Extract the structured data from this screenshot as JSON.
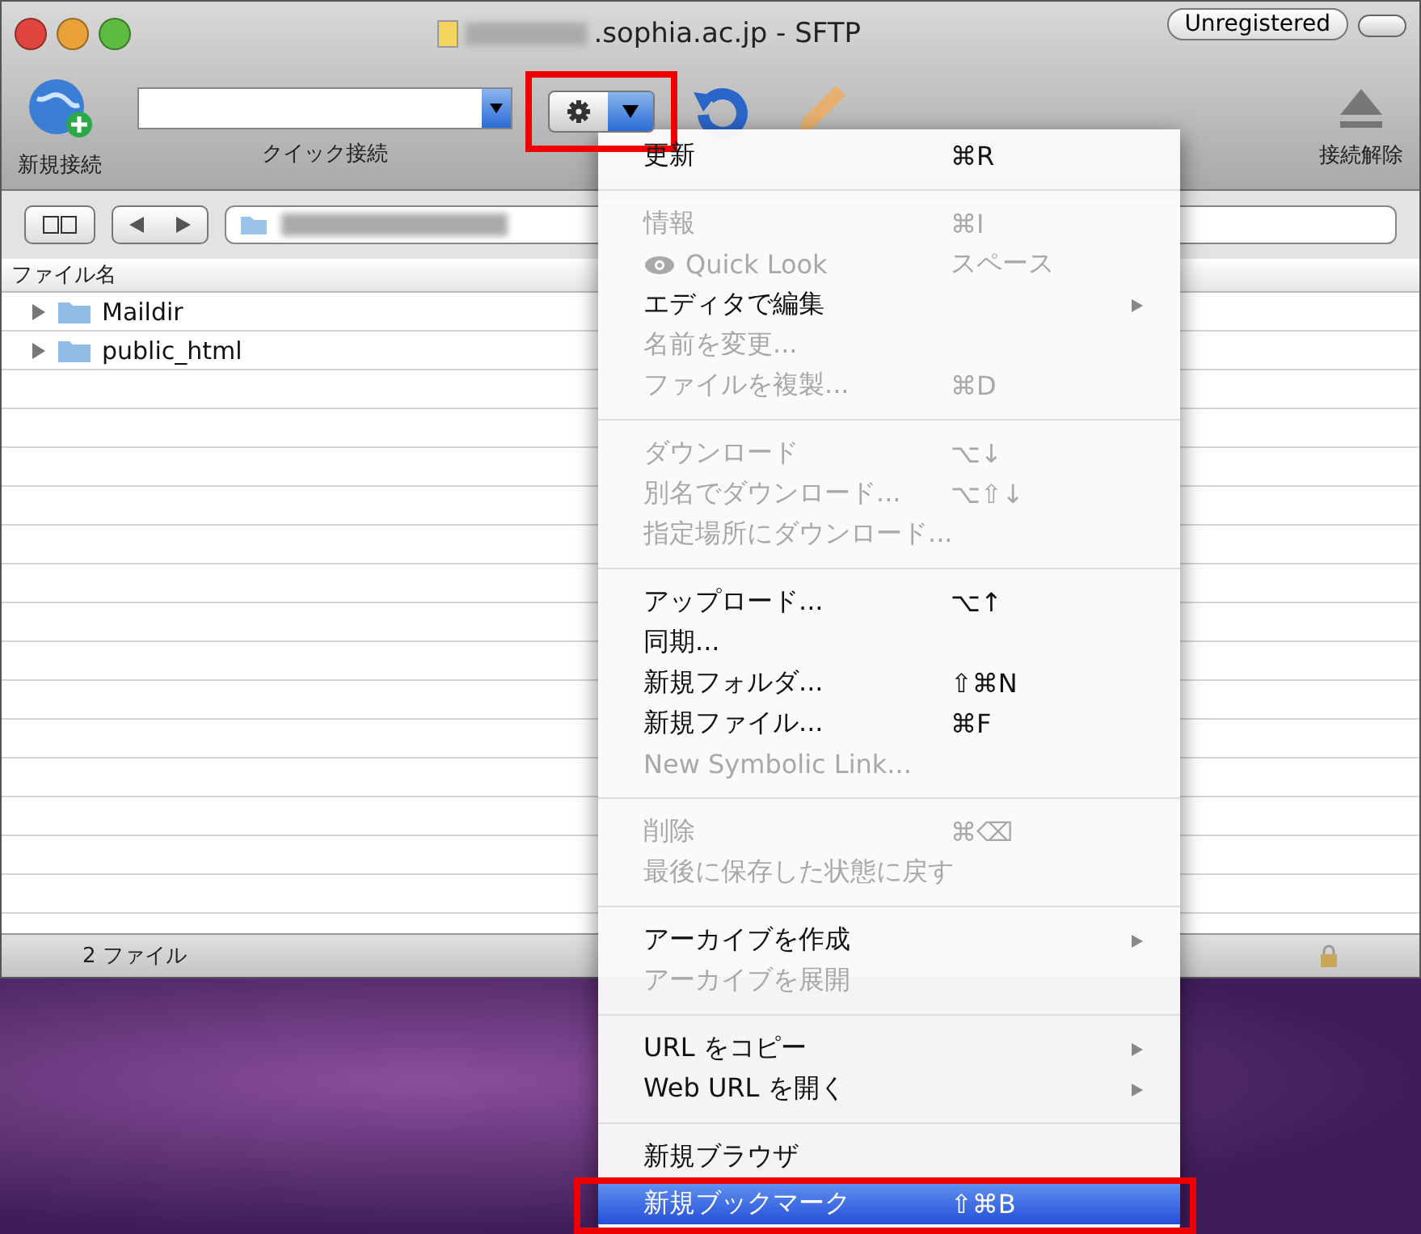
{
  "window": {
    "title": ".sophia.ac.jp - SFTP",
    "badge": "Unregistered"
  },
  "toolbar": {
    "items": [
      {
        "kind": "new-connection",
        "label": "新規接続"
      },
      {
        "kind": "quick-connect",
        "label": "クイック接続"
      },
      {
        "kind": "action",
        "annotated": true
      },
      {
        "kind": "refresh"
      },
      {
        "kind": "edit"
      },
      {
        "kind": "disconnect",
        "label": "接続解除"
      }
    ]
  },
  "file_list": {
    "columns": [
      "ファイル名"
    ],
    "rows": [
      {
        "name": "Maildir",
        "expanded": false
      },
      {
        "name": "public_html",
        "expanded": false
      }
    ]
  },
  "status_bar": {
    "text": "2 ファイル"
  },
  "menu": {
    "sections": [
      [
        {
          "kind": "command",
          "label": "更新",
          "shortcut": "⌘R",
          "disabled": false,
          "selected": false,
          "annotated": false
        }
      ],
      [
        {
          "kind": "command",
          "label": "情報",
          "shortcut": "⌘I",
          "disabled": true,
          "selected": false,
          "annotated": false
        },
        {
          "kind": "preview",
          "label": "Quick Look",
          "shortcut": "スペース",
          "disabled": true,
          "selected": false,
          "annotated": false
        },
        {
          "kind": "submenu",
          "label": "エディタで編集",
          "disabled": false,
          "selected": false,
          "annotated": false
        },
        {
          "kind": "command",
          "label": "名前を変更...",
          "disabled": true,
          "selected": false,
          "annotated": false
        },
        {
          "kind": "command",
          "label": "ファイルを複製...",
          "shortcut": "⌘D",
          "disabled": true,
          "selected": false,
          "annotated": false
        }
      ],
      [
        {
          "kind": "command",
          "label": "ダウンロード",
          "shortcut": "⌥↓",
          "disabled": true,
          "selected": false,
          "annotated": false
        },
        {
          "kind": "command",
          "label": "別名でダウンロード...",
          "shortcut": "⌥⇧↓",
          "disabled": true,
          "selected": false,
          "annotated": false
        },
        {
          "kind": "command",
          "label": "指定場所にダウンロード...",
          "disabled": true,
          "selected": false,
          "annotated": false
        }
      ],
      [
        {
          "kind": "command",
          "label": "アップロード...",
          "shortcut": "⌥↑",
          "disabled": false,
          "selected": false,
          "annotated": false
        },
        {
          "kind": "command",
          "label": "同期...",
          "disabled": false,
          "selected": false,
          "annotated": false
        },
        {
          "kind": "command",
          "label": "新規フォルダ...",
          "shortcut": "⇧⌘N",
          "disabled": false,
          "selected": false,
          "annotated": false
        },
        {
          "kind": "command",
          "label": "新規ファイル...",
          "shortcut": "⌘F",
          "disabled": false,
          "selected": false,
          "annotated": false
        },
        {
          "kind": "command",
          "label": "New Symbolic Link...",
          "disabled": true,
          "selected": false,
          "annotated": false
        }
      ],
      [
        {
          "kind": "command",
          "label": "削除",
          "shortcut": "⌘⌫",
          "disabled": true,
          "selected": false,
          "annotated": false
        },
        {
          "kind": "command",
          "label": "最後に保存した状態に戻す",
          "disabled": true,
          "selected": false,
          "annotated": false
        }
      ],
      [
        {
          "kind": "submenu",
          "label": "アーカイブを作成",
          "disabled": false,
          "selected": false,
          "annotated": false
        },
        {
          "kind": "command",
          "label": "アーカイブを展開",
          "disabled": true,
          "selected": false,
          "annotated": false
        }
      ],
      [
        {
          "kind": "submenu",
          "label": "URL をコピー",
          "disabled": false,
          "selected": false,
          "annotated": false
        },
        {
          "kind": "submenu",
          "label": "Web URL を開く",
          "disabled": false,
          "selected": false,
          "annotated": false
        }
      ],
      [
        {
          "kind": "command",
          "label": "新規ブラウザ",
          "disabled": false,
          "selected": false,
          "annotated": false
        },
        {
          "kind": "command",
          "label": "新規ブックマーク",
          "shortcut": "⇧⌘B",
          "disabled": false,
          "selected": true,
          "annotated": true
        }
      ]
    ]
  }
}
